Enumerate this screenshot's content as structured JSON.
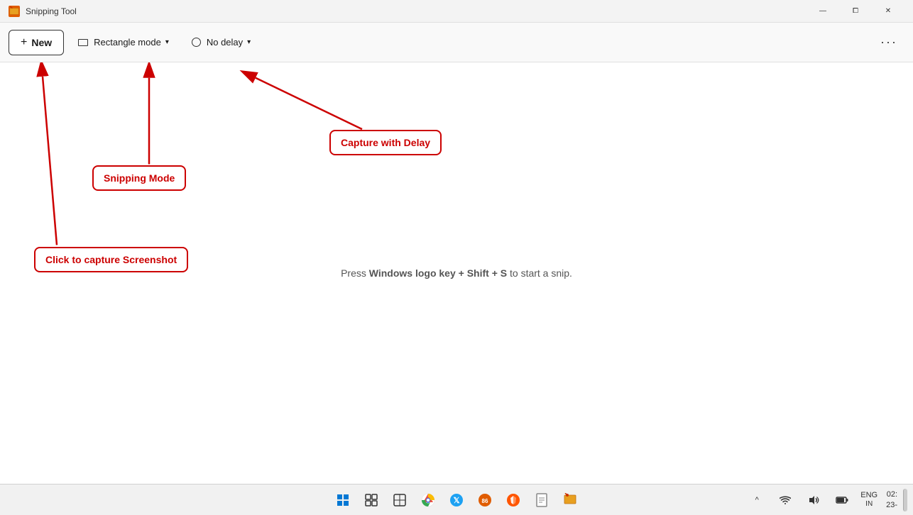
{
  "window": {
    "title": "Snipping Tool",
    "controls": {
      "minimize": "—",
      "maximize": "⧠",
      "close": "✕"
    }
  },
  "toolbar": {
    "new_label": "New",
    "mode_label": "Rectangle mode",
    "delay_label": "No delay",
    "more_label": "···"
  },
  "main": {
    "hint_prefix": "Press ",
    "hint_keys": "Windows logo key + Shift + S",
    "hint_suffix": " to start a snip."
  },
  "annotations": {
    "capture_with_delay": "Capture with Delay",
    "snipping_mode": "Snipping Mode",
    "click_to_capture": "Click to capture Screenshot"
  },
  "taskbar": {
    "icons": [
      {
        "name": "windows-start",
        "symbol": "⊞"
      },
      {
        "name": "task-view",
        "symbol": "▣"
      },
      {
        "name": "widgets",
        "symbol": "⊟"
      },
      {
        "name": "chrome",
        "symbol": "◉"
      },
      {
        "name": "twitter",
        "symbol": "🐦"
      },
      {
        "name": "brave",
        "symbol": "🛡"
      },
      {
        "name": "notepad",
        "symbol": "📋"
      },
      {
        "name": "snipping-tool",
        "symbol": "✂"
      }
    ],
    "sys_tray": {
      "chevron": "^",
      "wifi": "WiFi",
      "volume": "🔊",
      "battery": "🔋"
    },
    "language": "ENG\nIN",
    "time": "02:",
    "date": "23-"
  }
}
